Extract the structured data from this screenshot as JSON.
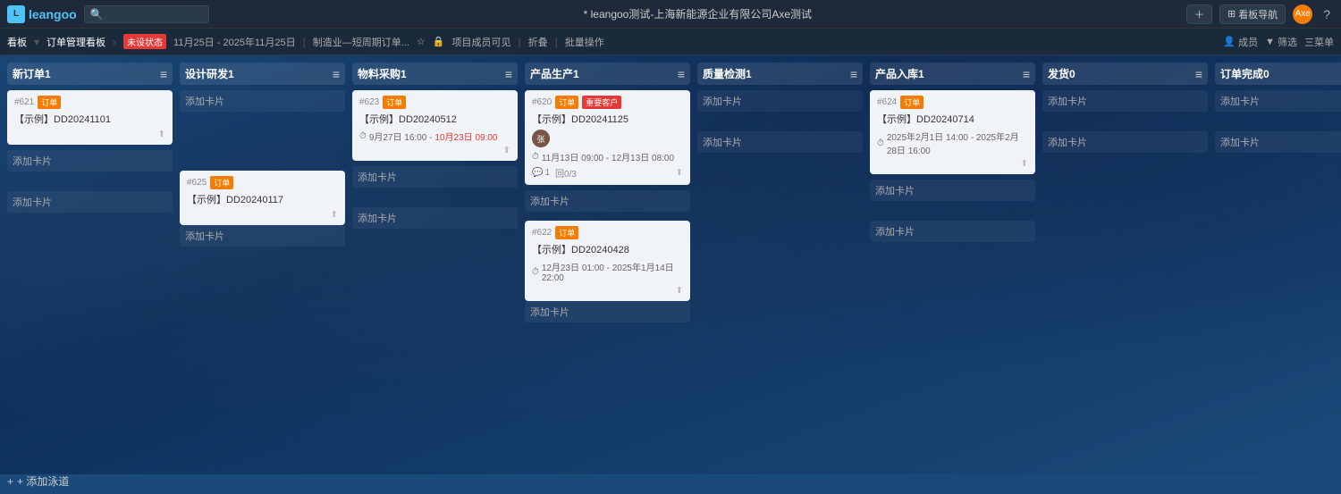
{
  "app": {
    "logo": "leangoo",
    "window_title": "* leangoo测试-上海新能源企业有限公司Axe测试"
  },
  "nav": {
    "search_placeholder": "",
    "board_label": "看板导航",
    "user_name": "Axe",
    "help_label": "?",
    "plus_label": "+",
    "grid_icon": "⊞"
  },
  "toolbar": {
    "board_label": "看板",
    "plan_title": "订单管理看板",
    "status_label": "未设状态",
    "date_range": "11月25日 - 2025年11月25日",
    "industry_label": "制造业—短周期订单...",
    "star_icon": "☆",
    "lock_icon": "🔒",
    "visibility_label": "项目成员可见",
    "fold_label": "折叠",
    "batch_label": "批量操作",
    "member_label": "成员",
    "filter_label": "筛选",
    "menu_label": "三菜单"
  },
  "columns": [
    {
      "id": "col1",
      "title": "新订单1",
      "count": "",
      "cards": [
        {
          "id": "#621",
          "tag": "订单",
          "tag_color": "orange",
          "title": "【示例】DD20241101",
          "date": "",
          "avatar": "",
          "comments": "",
          "warn": ""
        }
      ]
    },
    {
      "id": "col2",
      "title": "设计研发1",
      "count": "",
      "cards": []
    },
    {
      "id": "col3",
      "title": "物料采购1",
      "count": "",
      "cards": [
        {
          "id": "#623",
          "tag": "订单",
          "tag_color": "orange",
          "title": "【示例】DD20240512",
          "date": "9月27日 16:00 - 10月23日 09:00",
          "date_overdue": true,
          "avatar": "",
          "comments": "",
          "warn": ""
        }
      ]
    },
    {
      "id": "col4",
      "title": "产品生产1",
      "count": "",
      "cards": [
        {
          "id": "#620",
          "tag": "订单",
          "tag_color": "orange",
          "warn": "重要客户",
          "warn_color": "red",
          "title": "【示例】DD20241125",
          "avatar": "张",
          "date": "11月13日 09:00 - 12月13日 08:00",
          "date_overdue": false,
          "comments": "1",
          "progress": "回0/3"
        }
      ]
    },
    {
      "id": "col5",
      "title": "质量检测1",
      "count": "",
      "cards": []
    },
    {
      "id": "col6",
      "title": "产品入库1",
      "count": "",
      "cards": [
        {
          "id": "#624",
          "tag": "订单",
          "tag_color": "orange",
          "title": "【示例】DD20240714",
          "date": "2025年2月1日 14:00  -  2025年2月28日 16:00",
          "date_overdue": false,
          "avatar": "",
          "comments": "",
          "warn": ""
        }
      ]
    },
    {
      "id": "col7",
      "title": "发货0",
      "count": "",
      "cards": []
    },
    {
      "id": "col8",
      "title": "订单完成0",
      "count": "",
      "cards": []
    }
  ],
  "second_row_cards": [
    {
      "col": "col2",
      "id": "#625",
      "tag": "订单",
      "tag_color": "orange",
      "title": "【示例】DD20240117",
      "date": "",
      "avatar": "",
      "comments": "",
      "warn": ""
    },
    {
      "col": "col4",
      "id": "#622",
      "tag": "订单",
      "tag_color": "orange",
      "title": "【示例】DD20240428",
      "date": "12月23日 01:00  -  2025年1月14日 22:00",
      "date_overdue": false,
      "avatar": "",
      "comments": "",
      "warn": ""
    }
  ],
  "add_lane_label": "+ 添加泳道",
  "add_card_label": "添加卡片"
}
